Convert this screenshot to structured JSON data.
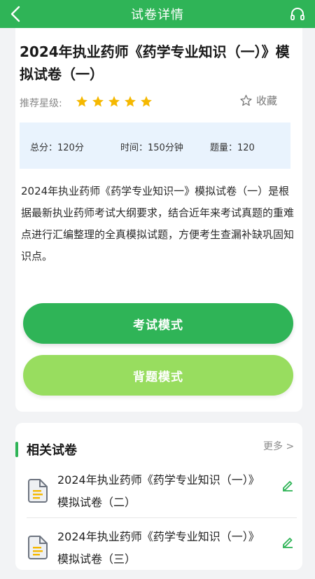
{
  "header": {
    "title": "试卷详情",
    "back_icon": "back-arrow-icon",
    "headset_icon": "headset-icon"
  },
  "paper": {
    "title": "2024年执业药师《药学专业知识（一）》模拟试卷（一）",
    "rating_label": "推荐星级:",
    "stars": 5,
    "favorite_label": "收藏",
    "info": {
      "total_score": "总分：120分",
      "duration": "时间：150分钟",
      "question_count": "题量：120"
    },
    "description": "2024年执业药师《药学专业知识一》模拟试卷（一）是根据最新执业药师考试大纲要求，结合近年来考试真题的重难点进行汇编整理的全真模拟试题，方便考生查漏补缺巩固知识点。"
  },
  "buttons": {
    "exam_mode": "考试模式",
    "recite_mode": "背题模式"
  },
  "related": {
    "title": "相关试卷",
    "more": "更多 >",
    "items": [
      {
        "title": "2024年执业药师《药学专业知识（一）》模拟试卷（二）"
      },
      {
        "title": "2024年执业药师《药学专业知识（一）》模拟试卷（三）"
      }
    ]
  },
  "colors": {
    "primary": "#2fb457",
    "secondary_button": "#98dd5f",
    "star": "#f5b800",
    "info_bg": "#e9f3fd"
  }
}
